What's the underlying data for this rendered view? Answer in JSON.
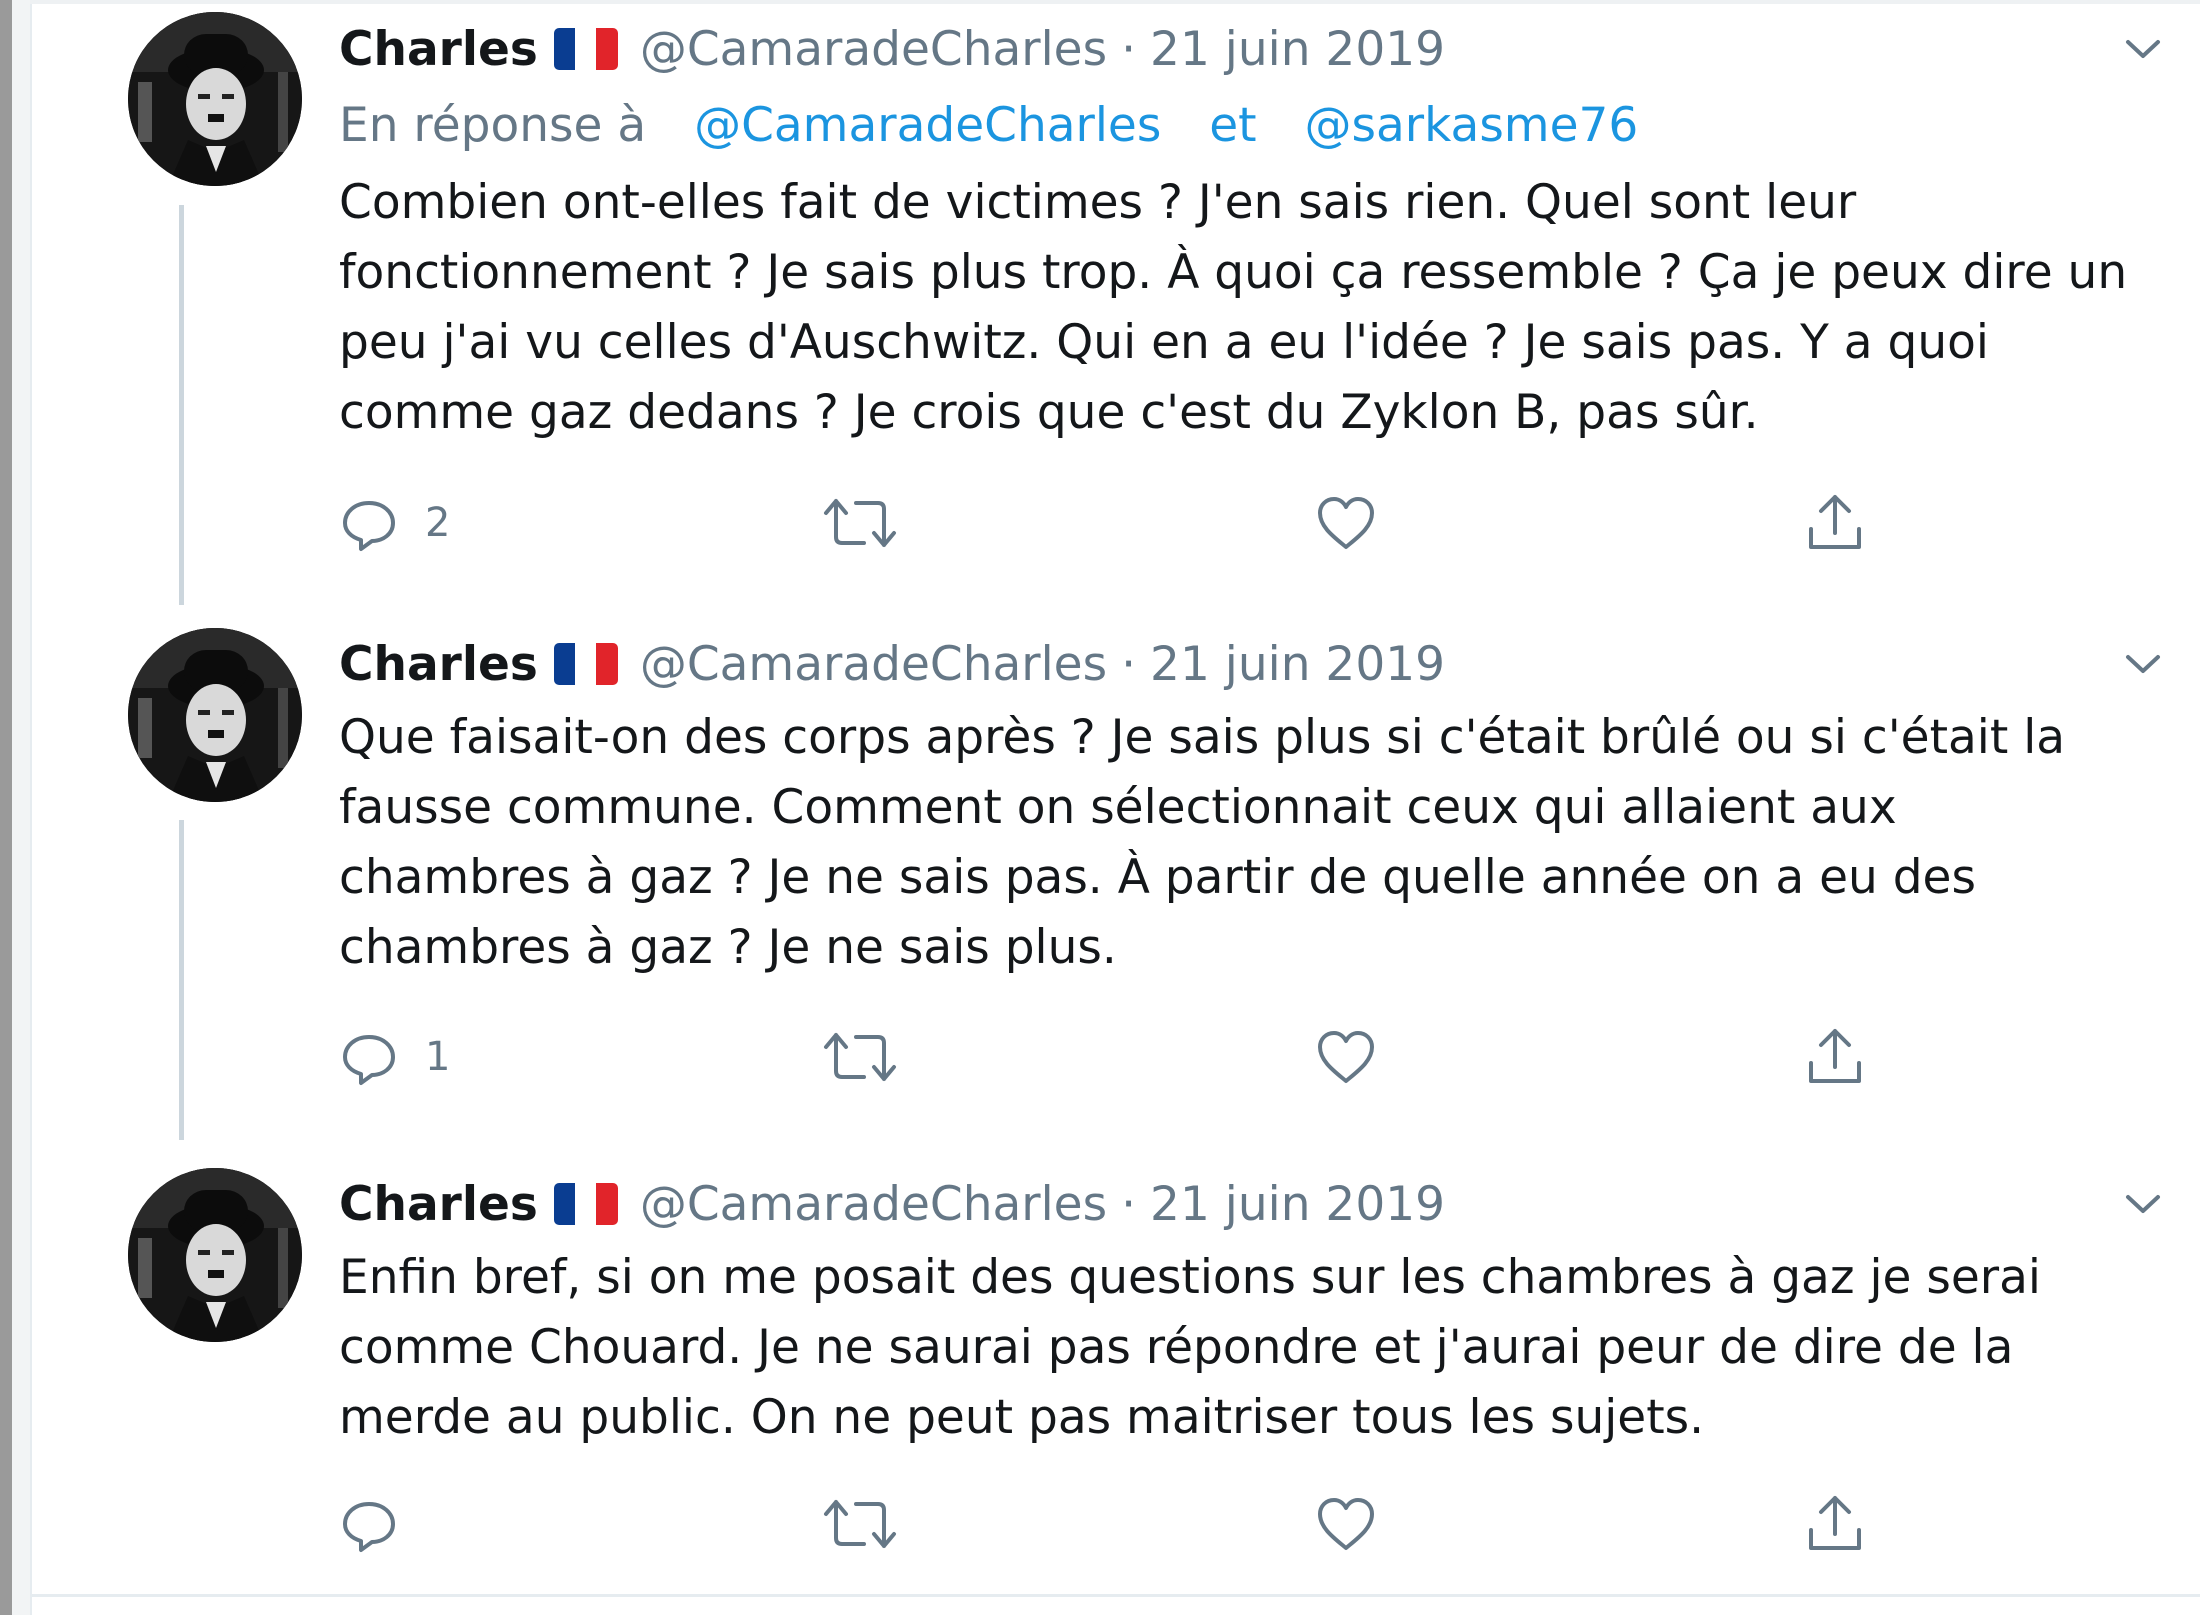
{
  "tweets": [
    {
      "name": "Charles",
      "handle": "@CamaradeCharles",
      "separator": "·",
      "date": "21 juin 2019",
      "reply_prefix": "En réponse à",
      "reply_mentions": [
        "@CamaradeCharles",
        "@sarkasme76"
      ],
      "reply_conjunction": "et",
      "text": "Combien ont-elles fait de victimes ? J'en sais rien. Quel sont leur\nfonctionnement ? Je sais plus trop. À quoi ça ressemble ? Ça je peux dire un\npeu j'ai vu celles d'Auschwitz. Qui en a eu l'idée ? Je sais pas. Y a quoi\ncomme gaz dedans ? Je crois que c'est du Zyklon B, pas sûr.",
      "reply_count": "2"
    },
    {
      "name": "Charles",
      "handle": "@CamaradeCharles",
      "separator": "·",
      "date": "21 juin 2019",
      "text": "Que faisait-on des corps après ? Je sais plus si c'était brûlé ou si c'était la\nfausse commune. Comment on sélectionnait ceux qui allaient aux\nchambres à gaz ? Je ne sais pas. À partir de quelle année on a eu des\nchambres à gaz ? Je ne sais plus.",
      "reply_count": "1"
    },
    {
      "name": "Charles",
      "handle": "@CamaradeCharles",
      "separator": "·",
      "date": "21 juin 2019",
      "text": "Enfin bref, si on me posait des questions sur les chambres à gaz je serai\ncomme Chouard. Je ne saurai pas répondre et j'aurai peur de dire de la\nmerde au public. On ne peut pas maitriser tous les sujets.",
      "reply_count": ""
    }
  ],
  "icons": {
    "reply": "reply-icon",
    "retweet": "retweet-icon",
    "like": "like-icon",
    "share": "share-icon",
    "more": "chevron-down-icon",
    "flag": "france-flag-icon"
  },
  "colors": {
    "text": "#14171a",
    "secondary": "#657786",
    "link": "#1b95e0",
    "thread_line": "#ccd6dd",
    "flag_blue": "#0a3d91",
    "flag_white": "#ffffff",
    "flag_red": "#e1242a"
  }
}
